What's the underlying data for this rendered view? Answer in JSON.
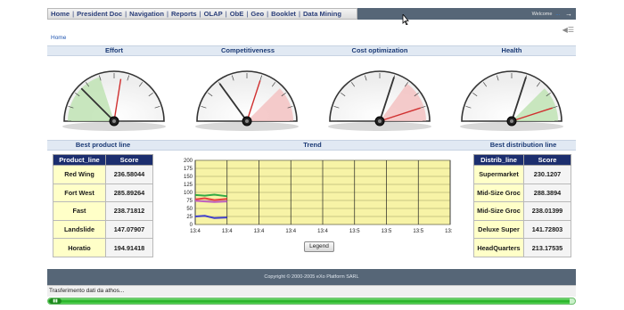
{
  "nav": {
    "links": [
      "Home",
      "President Doc",
      "Navigation",
      "Reports",
      "OLAP",
      "ObE",
      "Geo",
      "Booklet",
      "Data Mining"
    ],
    "welcome": "Welcome",
    "user": "...",
    "arrow": "→"
  },
  "breadcrumb": "Home",
  "gauges": [
    {
      "title": "Effort",
      "value": 25,
      "green_band": [
        0,
        40
      ],
      "red_band": null
    },
    {
      "title": "Competitiveness",
      "value": 30,
      "green_band": null,
      "red_band": [
        75,
        100
      ]
    },
    {
      "title": "Cost optimization",
      "value": 60,
      "green_band": null,
      "red_band": [
        70,
        100
      ]
    },
    {
      "title": "Health",
      "value": 60,
      "green_band": [
        75,
        100
      ],
      "red_band": null
    }
  ],
  "sections": {
    "best_product": "Best product line",
    "trend": "Trend",
    "best_distribution": "Best distribution line"
  },
  "product_table": {
    "headers": [
      "Product_line",
      "Score"
    ],
    "rows": [
      [
        "Red Wing",
        "236.58044"
      ],
      [
        "Fort West",
        "285.89264"
      ],
      [
        "Fast",
        "238.71812"
      ],
      [
        "Landslide",
        "147.07907"
      ],
      [
        "Horatio",
        "194.91418"
      ]
    ]
  },
  "distribution_table": {
    "headers": [
      "Distrib_line",
      "Score"
    ],
    "rows": [
      [
        "Supermarket",
        "230.1207"
      ],
      [
        "Mid-Size Groc",
        "288.3894"
      ],
      [
        "Mid-Size Groc",
        "238.01399"
      ],
      [
        "Deluxe Super",
        "141.72803"
      ],
      [
        "HeadQuarters",
        "213.17535"
      ]
    ]
  },
  "chart_data": {
    "type": "line",
    "title": "Trend",
    "x": [
      "13:4",
      "13:4",
      "13:4",
      "13:4",
      "13:4",
      "13:5",
      "13:5",
      "13:5",
      "13:5"
    ],
    "y_ticks": [
      0,
      25,
      50,
      75,
      100,
      125,
      150,
      175,
      200
    ],
    "ylim": [
      0,
      200
    ],
    "grid": true,
    "series": [
      {
        "color": "#33aa44",
        "points": [
          [
            0,
            92
          ],
          [
            0.3,
            90
          ],
          [
            0.6,
            93
          ],
          [
            1,
            88
          ]
        ]
      },
      {
        "color": "#e84040",
        "points": [
          [
            0,
            78
          ],
          [
            0.3,
            82
          ],
          [
            0.6,
            76
          ],
          [
            1,
            80
          ]
        ]
      },
      {
        "color": "#c060c0",
        "points": [
          [
            0,
            74
          ],
          [
            0.3,
            72
          ],
          [
            0.6,
            70
          ],
          [
            1,
            72
          ]
        ]
      },
      {
        "color": "#4040cc",
        "points": [
          [
            0,
            25
          ],
          [
            0.3,
            27
          ],
          [
            0.6,
            20
          ],
          [
            1,
            22
          ]
        ]
      }
    ]
  },
  "legend_button": "Legend",
  "footer": "Copyright © 2000-2005 eXo Platform SARL",
  "status": "Trasferimento dati da athos...",
  "progress": {
    "fraction": 0.99,
    "handle_icon": "▮▮"
  }
}
